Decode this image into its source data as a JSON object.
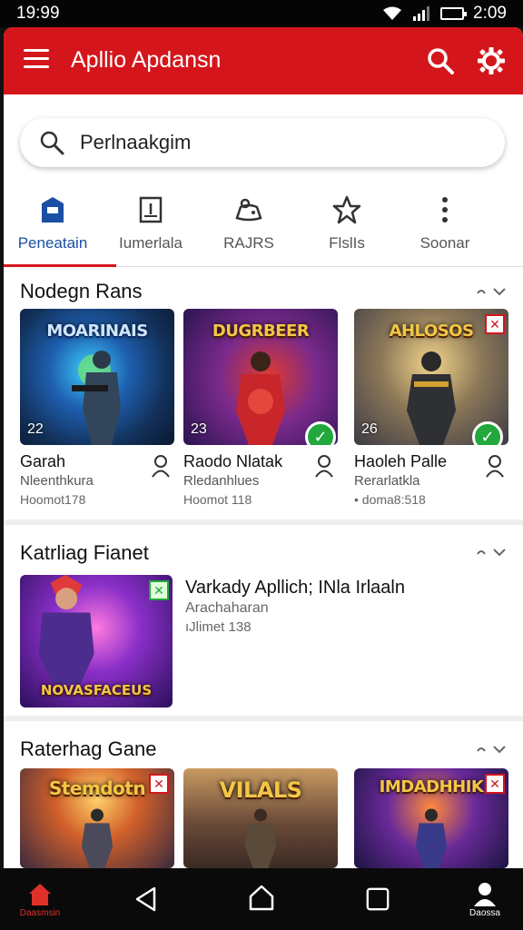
{
  "status_bar": {
    "time": "19:99",
    "clock_right": "2:09"
  },
  "app_bar": {
    "title": "Apllio Apdansn"
  },
  "search": {
    "placeholder": "Perlnaakgim"
  },
  "tabs": [
    {
      "label": "Peneatain",
      "icon": "shopping-bag-icon",
      "active": true
    },
    {
      "label": "Iumerlala",
      "icon": "document-icon",
      "active": false
    },
    {
      "label": "RAJRS",
      "icon": "game-controller-icon",
      "active": false
    },
    {
      "label": "FlslIs",
      "icon": "star-icon",
      "active": false
    },
    {
      "label": "Soonar",
      "icon": "more-vertical-icon",
      "active": false
    }
  ],
  "sections": {
    "first": {
      "title": "Nodegn Rans",
      "cards": [
        {
          "art_title": "MOARINAIS",
          "number": "22",
          "name": "Garah",
          "sub": "Nleenthkura",
          "meta": "Hoomot178",
          "badge": "none"
        },
        {
          "art_title": "DUGRBEER",
          "number": "23",
          "name": "Raodo Nlatak",
          "sub": "Rledanhlues",
          "meta": "Hoomot 118",
          "badge": "check"
        },
        {
          "art_title": "AHLOSOS",
          "number": "26",
          "name": "Haoleh Palle",
          "sub": "Rerarlatkla",
          "meta": "• doma8:518",
          "badge": "check-flag"
        }
      ]
    },
    "second": {
      "title": "Katrliag Fianet",
      "feature": {
        "art_title": "NOVASFACEUS",
        "name": "Varkady Apllich; INla Irlaaln",
        "sub": "Arachaharan",
        "meta": "ıJlimet 138"
      }
    },
    "third": {
      "title": "Raterhag Gane",
      "cards": [
        {
          "art_title": "Stemdotn"
        },
        {
          "art_title": "VILALS"
        },
        {
          "art_title": "IMDADHHIK"
        }
      ]
    }
  },
  "bottom_nav": {
    "home_label": "Daasmsin",
    "profile_label": "Daossa"
  },
  "colors": {
    "accent": "#d4161c",
    "active_tab": "#1a4fa3",
    "success": "#22a83c"
  }
}
